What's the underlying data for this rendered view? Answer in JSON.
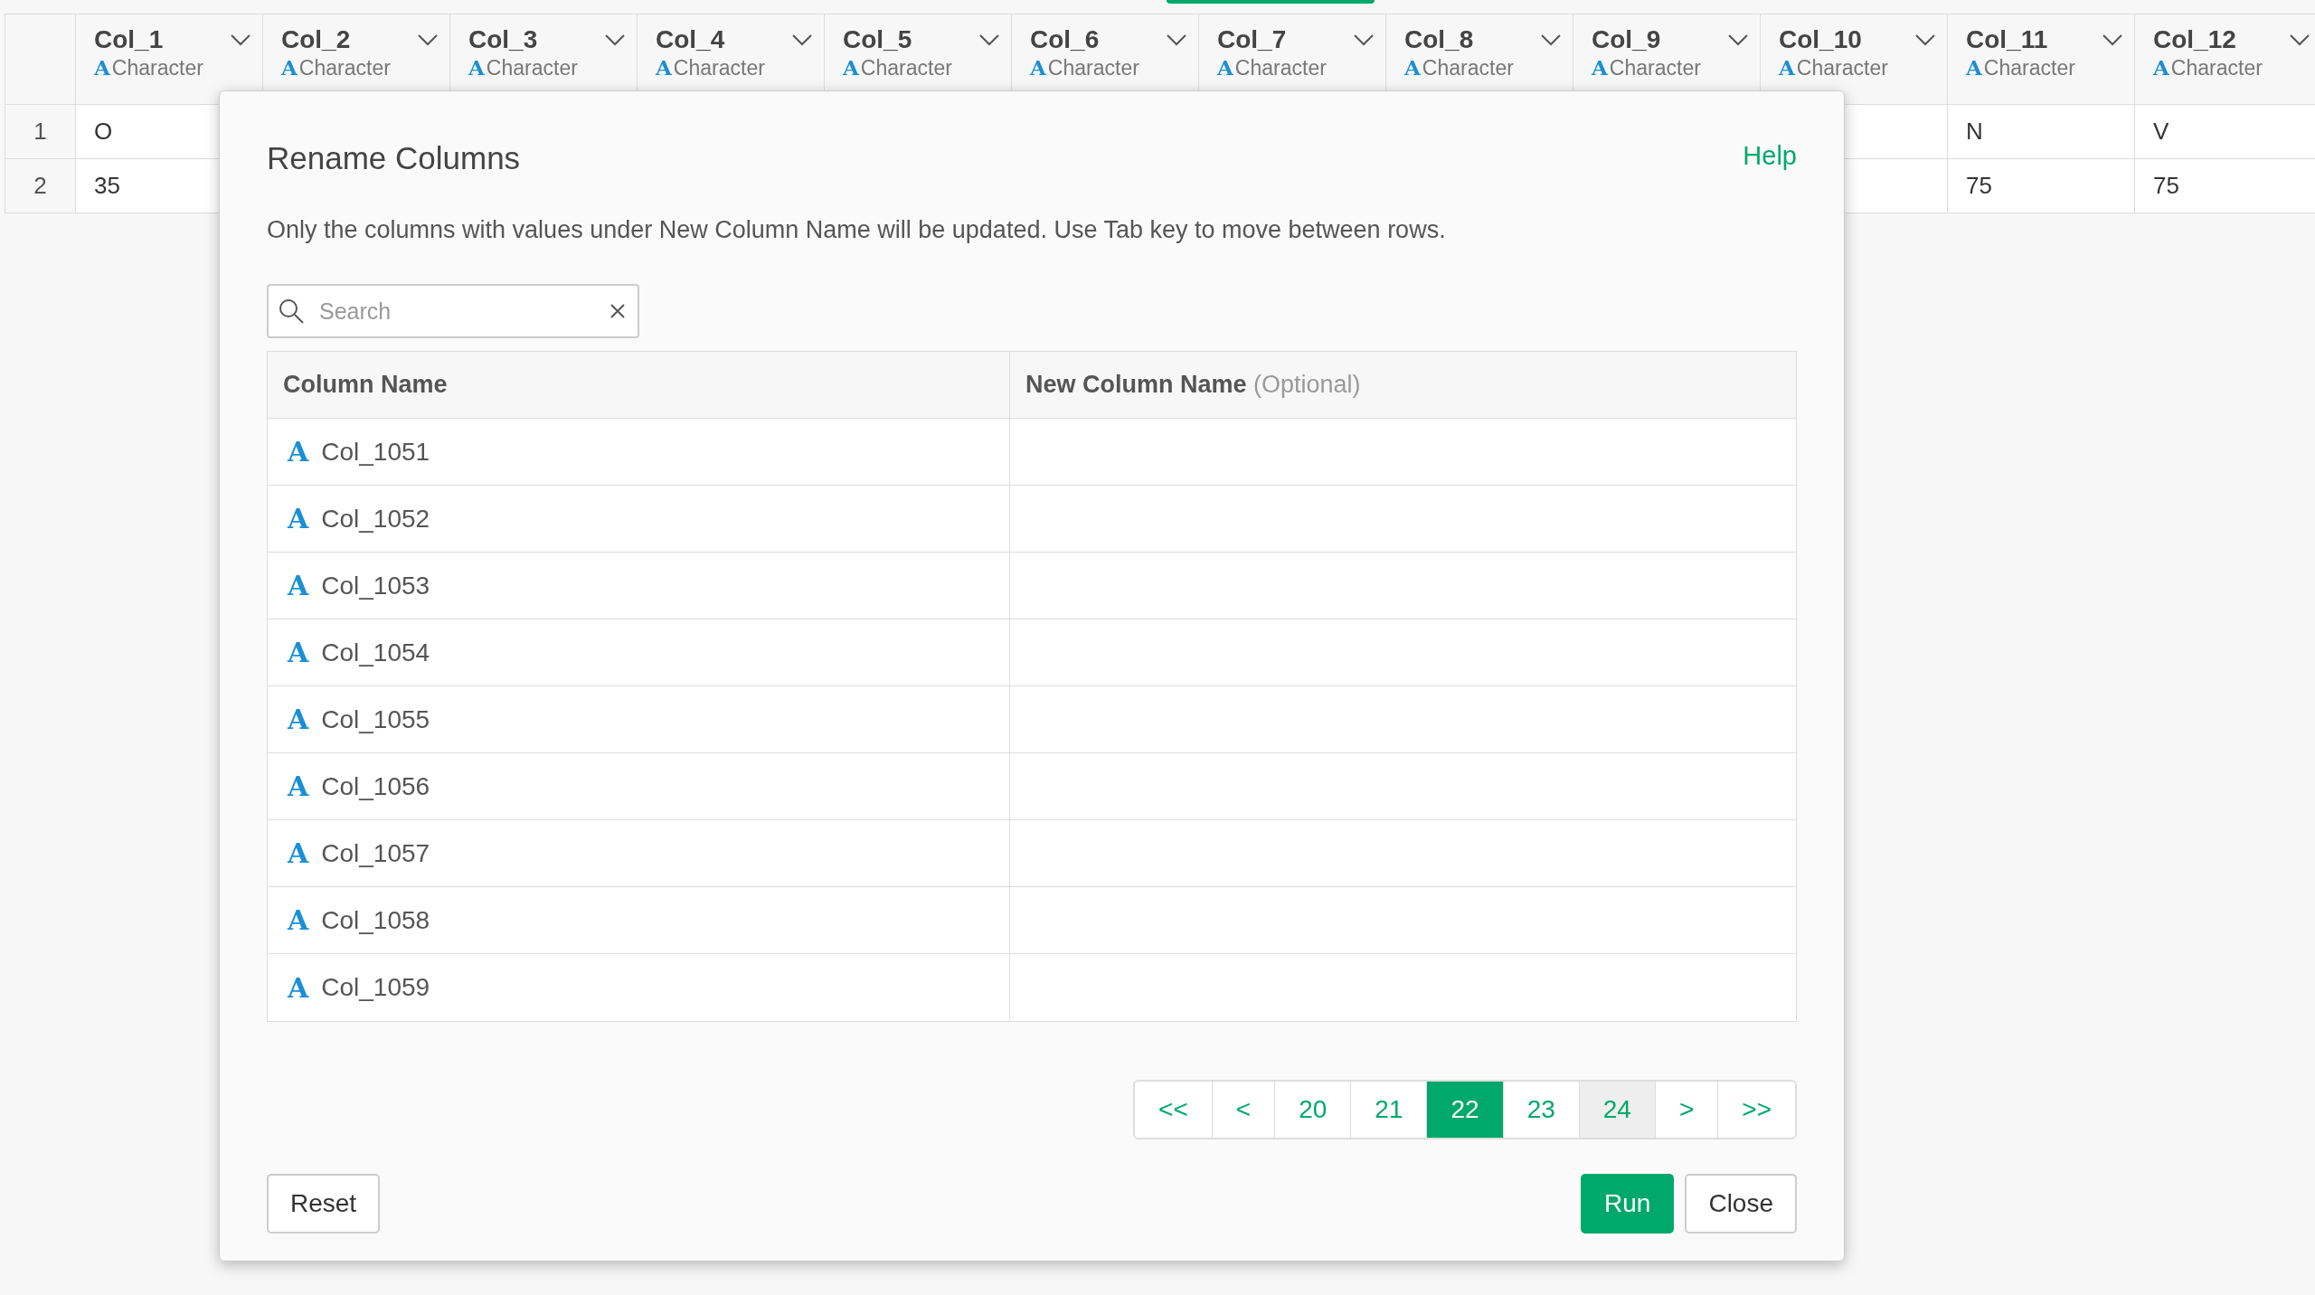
{
  "grid": {
    "columns": [
      {
        "name": "Col_1",
        "type_icon": "A",
        "type": "Character"
      },
      {
        "name": "Col_2",
        "type_icon": "A",
        "type": "Character"
      },
      {
        "name": "Col_3",
        "type_icon": "A",
        "type": "Character"
      },
      {
        "name": "Col_4",
        "type_icon": "A",
        "type": "Character"
      },
      {
        "name": "Col_5",
        "type_icon": "A",
        "type": "Character"
      },
      {
        "name": "Col_6",
        "type_icon": "A",
        "type": "Character"
      },
      {
        "name": "Col_7",
        "type_icon": "A",
        "type": "Character"
      },
      {
        "name": "Col_8",
        "type_icon": "A",
        "type": "Character"
      },
      {
        "name": "Col_9",
        "type_icon": "A",
        "type": "Character"
      },
      {
        "name": "Col_10",
        "type_icon": "A",
        "type": "Character"
      },
      {
        "name": "Col_11",
        "type_icon": "A",
        "type": "Character"
      },
      {
        "name": "Col_12",
        "type_icon": "A",
        "type": "Character"
      }
    ],
    "rows": [
      {
        "number": "1",
        "col_1": "O",
        "col_11": "N",
        "col_12": "V"
      },
      {
        "number": "2",
        "col_1": "35",
        "col_11": "75",
        "col_12": "75"
      }
    ]
  },
  "dialog": {
    "title": "Rename Columns",
    "help": "Help",
    "description": "Only the columns with values under New Column Name will be updated. Use Tab key to move between rows.",
    "search": {
      "placeholder": "Search"
    },
    "table": {
      "columns": [
        "Column Name",
        "New Column Name"
      ],
      "optional_note": "(Optional)",
      "rows": [
        {
          "type_icon": "A",
          "name": "Col_1051"
        },
        {
          "type_icon": "A",
          "name": "Col_1052"
        },
        {
          "type_icon": "A",
          "name": "Col_1053"
        },
        {
          "type_icon": "A",
          "name": "Col_1054"
        },
        {
          "type_icon": "A",
          "name": "Col_1055"
        },
        {
          "type_icon": "A",
          "name": "Col_1056"
        },
        {
          "type_icon": "A",
          "name": "Col_1057"
        },
        {
          "type_icon": "A",
          "name": "Col_1058"
        },
        {
          "type_icon": "A",
          "name": "Col_1059"
        }
      ]
    },
    "pagination": [
      {
        "label": "<<",
        "selected": false,
        "hovered": false
      },
      {
        "label": "<",
        "selected": false,
        "hovered": false
      },
      {
        "label": "20",
        "selected": false,
        "hovered": false
      },
      {
        "label": "21",
        "selected": false,
        "hovered": false
      },
      {
        "label": "22",
        "selected": true,
        "hovered": false
      },
      {
        "label": "23",
        "selected": false,
        "hovered": false
      },
      {
        "label": "24",
        "selected": false,
        "hovered": true
      },
      {
        "label": ">",
        "selected": false,
        "hovered": false
      },
      {
        "label": ">>",
        "selected": false,
        "hovered": false
      }
    ],
    "buttons": {
      "reset": "Reset",
      "run": "Run",
      "close": "Close"
    }
  }
}
